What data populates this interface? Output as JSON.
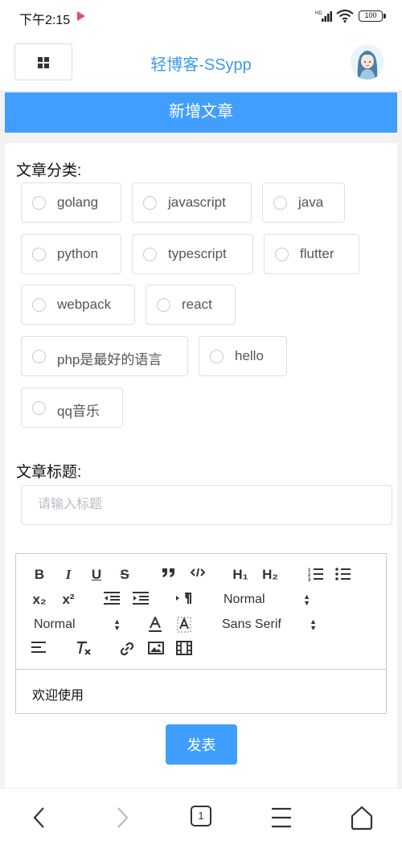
{
  "status_bar": {
    "time": "下午2:15",
    "network": "HD",
    "battery": "100"
  },
  "header": {
    "title": "轻博客-SSypp"
  },
  "banner": {
    "title": "新增文章"
  },
  "form": {
    "category_label": "文章分类:",
    "categories": [
      "golang",
      "javascript",
      "java",
      "python",
      "typescript",
      "flutter",
      "webpack",
      "react",
      "php是最好的语言",
      "hello",
      "qq音乐"
    ],
    "title_label": "文章标题:",
    "title_placeholder": "请输入标题",
    "title_value": ""
  },
  "editor": {
    "toolbar": {
      "bold": "B",
      "italic": "I",
      "underline": "U",
      "strike": "S",
      "h1": "H₁",
      "h2": "H₂",
      "sub": "x₂",
      "sup": "x²",
      "header_picker": "Normal",
      "size_picker": "Normal",
      "font_picker": "Sans Serif"
    },
    "content": "欢迎使用"
  },
  "submit": {
    "label": "发表"
  },
  "bottom_nav": {
    "tab_count": "1"
  }
}
